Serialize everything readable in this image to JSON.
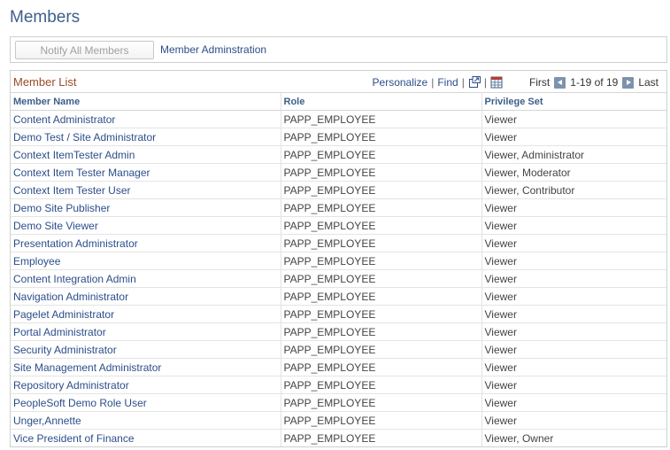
{
  "page": {
    "title": "Members"
  },
  "toolbar": {
    "notify_label": "Notify All Members",
    "admin_link": "Member Adminstration"
  },
  "grid": {
    "title": "Member List",
    "personalize": "Personalize",
    "sep": "|",
    "find": "Find",
    "first": "First",
    "range": "1-19 of 19",
    "last": "Last",
    "columns": [
      "Member Name",
      "Role",
      "Privilege Set"
    ],
    "rows": [
      {
        "name": "Content Administrator",
        "role": "PAPP_EMPLOYEE",
        "privilege": "Viewer"
      },
      {
        "name": "Demo Test / Site Administrator",
        "role": "PAPP_EMPLOYEE",
        "privilege": "Viewer"
      },
      {
        "name": "Context ItemTester Admin",
        "role": "PAPP_EMPLOYEE",
        "privilege": "Viewer, Administrator"
      },
      {
        "name": "Context Item Tester Manager",
        "role": "PAPP_EMPLOYEE",
        "privilege": "Viewer, Moderator"
      },
      {
        "name": "Context Item Tester User",
        "role": "PAPP_EMPLOYEE",
        "privilege": "Viewer, Contributor"
      },
      {
        "name": "Demo Site Publisher",
        "role": "PAPP_EMPLOYEE",
        "privilege": "Viewer"
      },
      {
        "name": "Demo Site Viewer",
        "role": "PAPP_EMPLOYEE",
        "privilege": "Viewer"
      },
      {
        "name": "Presentation Administrator",
        "role": "PAPP_EMPLOYEE",
        "privilege": "Viewer"
      },
      {
        "name": "Employee",
        "role": "PAPP_EMPLOYEE",
        "privilege": "Viewer"
      },
      {
        "name": "Content Integration Admin",
        "role": "PAPP_EMPLOYEE",
        "privilege": "Viewer"
      },
      {
        "name": "Navigation Administrator",
        "role": "PAPP_EMPLOYEE",
        "privilege": "Viewer"
      },
      {
        "name": "Pagelet Administrator",
        "role": "PAPP_EMPLOYEE",
        "privilege": "Viewer"
      },
      {
        "name": "Portal Administrator",
        "role": "PAPP_EMPLOYEE",
        "privilege": "Viewer"
      },
      {
        "name": "Security Administrator",
        "role": "PAPP_EMPLOYEE",
        "privilege": "Viewer"
      },
      {
        "name": "Site Management Administrator",
        "role": "PAPP_EMPLOYEE",
        "privilege": "Viewer"
      },
      {
        "name": "Repository Administrator",
        "role": "PAPP_EMPLOYEE",
        "privilege": "Viewer"
      },
      {
        "name": "PeopleSoft Demo Role User",
        "role": "PAPP_EMPLOYEE",
        "privilege": "Viewer"
      },
      {
        "name": "Unger,Annette",
        "role": "PAPP_EMPLOYEE",
        "privilege": "Viewer"
      },
      {
        "name": "Vice President of Finance",
        "role": "PAPP_EMPLOYEE",
        "privilege": "Viewer, Owner"
      }
    ]
  },
  "icons": {
    "new_window": "new-window-icon",
    "download": "download-to-spreadsheet-icon",
    "previous": "previous-arrow-icon",
    "next": "next-arrow-icon"
  },
  "colors": {
    "title": "#3d5f8a",
    "link": "#2c4e8a",
    "grid_title": "#9c4a2a",
    "nav_arrow": "#7d93ad"
  }
}
